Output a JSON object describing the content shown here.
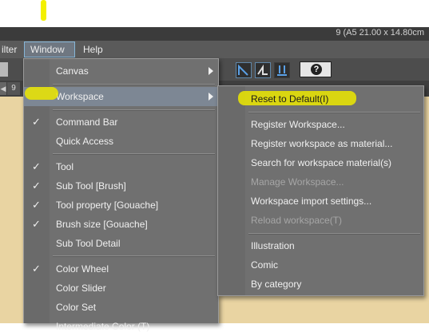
{
  "titlebar": {
    "document_info": "9 (A5 21.00 x 14.80cm"
  },
  "menubar": {
    "items": [
      {
        "label": "ilter"
      },
      {
        "label": "Window"
      },
      {
        "label": "Help"
      }
    ]
  },
  "toolbar": {
    "help_button_glyph": "?"
  },
  "tabstrip": {
    "tab_number": "9"
  },
  "window_menu": {
    "items": [
      {
        "label": "Canvas"
      },
      {
        "label": "Workspace"
      },
      {
        "label": "Command Bar"
      },
      {
        "label": "Quick Access"
      },
      {
        "label": "Tool"
      },
      {
        "label": "Sub Tool [Brush]"
      },
      {
        "label": "Tool property [Gouache]"
      },
      {
        "label": "Brush size [Gouache]"
      },
      {
        "label": "Sub Tool Detail"
      },
      {
        "label": "Color Wheel"
      },
      {
        "label": "Color Slider"
      },
      {
        "label": "Color Set"
      },
      {
        "label": "Intermediate Color (T)"
      }
    ]
  },
  "workspace_submenu": {
    "items": [
      {
        "label": "Reset to Default(I)"
      },
      {
        "label": "Register Workspace..."
      },
      {
        "label": "Register workspace as material..."
      },
      {
        "label": "Search for workspace material(s)"
      },
      {
        "label": "Manage Workspace..."
      },
      {
        "label": "Workspace import settings..."
      },
      {
        "label": "Reload workspace(T)"
      },
      {
        "label": "Illustration"
      },
      {
        "label": "Comic"
      },
      {
        "label": "By category"
      }
    ]
  },
  "colors": {
    "highlighter": "#f3f000",
    "menu_bg": "#707070",
    "canvas_bg": "#e9d4a2",
    "menubar_bg": "#5a5a5a"
  }
}
